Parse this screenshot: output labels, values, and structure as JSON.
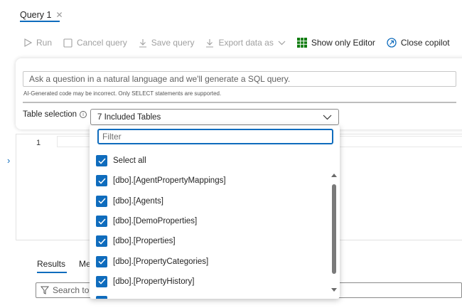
{
  "tab": {
    "title": "Query 1",
    "close": "✕"
  },
  "toolbar": {
    "run": "Run",
    "cancel_query": "Cancel query",
    "save_query": "Save query",
    "export_data": "Export data as",
    "show_only_editor": "Show only Editor",
    "close_copilot": "Close copilot"
  },
  "copilot": {
    "placeholder": "Ask a question in a natural language and we'll generate a SQL query.",
    "disclaimer": "AI-Generated code may be incorrect. Only SELECT statements are supported.",
    "table_selection_label": "Table selection",
    "table_selection_value": "7 Included Tables"
  },
  "dropdown": {
    "filter_placeholder": "Filter",
    "items": [
      {
        "label": "Select all",
        "checked": true
      },
      {
        "label": "[dbo].[AgentPropertyMappings]",
        "checked": true
      },
      {
        "label": "[dbo].[Agents]",
        "checked": true
      },
      {
        "label": "[dbo].[DemoProperties]",
        "checked": true
      },
      {
        "label": "[dbo].[Properties]",
        "checked": true
      },
      {
        "label": "[dbo].[PropertyCategories]",
        "checked": true
      },
      {
        "label": "[dbo].[PropertyHistory]",
        "checked": true
      }
    ]
  },
  "editor": {
    "line_number": "1"
  },
  "results": {
    "results_tab": "Results",
    "messages_tab": "Me",
    "search_placeholder": "Search to f"
  },
  "colors": {
    "accent": "#0f6cbd",
    "excel_green": "#107c10"
  }
}
